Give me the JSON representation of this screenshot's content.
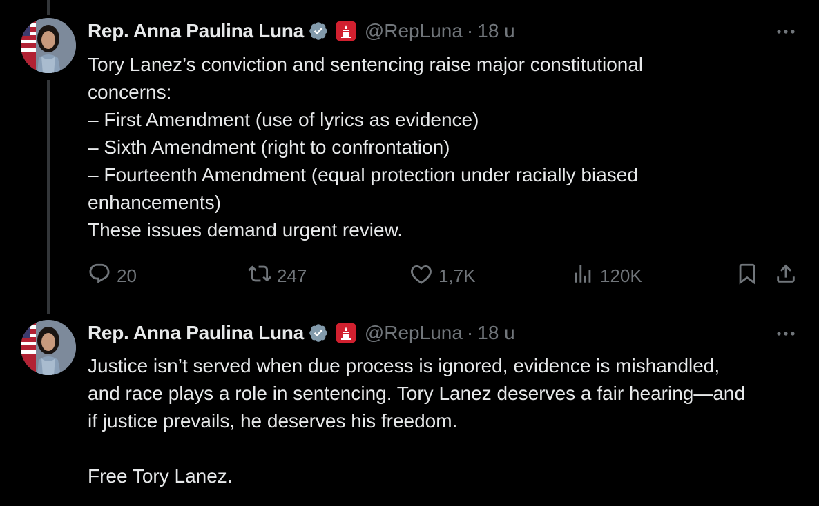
{
  "colors": {
    "background": "#000000",
    "text": "#e7e9ea",
    "muted": "#71767b",
    "verified": "#829aab",
    "gov_badge": "#d1202f"
  },
  "tweets": [
    {
      "author_name": "Rep. Anna Paulina Luna",
      "handle": "@RepLuna",
      "separator": "·",
      "time": "18 u",
      "text": "Tory Lanez’s conviction and sentencing raise major constitutional\nconcerns:\n– First Amendment (use of lyrics as evidence)\n– Sixth Amendment (right to confrontation)\n– Fourteenth Amendment (equal protection under racially biased\nenhancements)\nThese issues demand urgent review.",
      "replies": "20",
      "reposts": "247",
      "likes": "1,7K",
      "views": "120K",
      "icons": [
        "verified-icon",
        "government-badge-icon",
        "more-icon",
        "reply-icon",
        "repost-icon",
        "like-icon",
        "views-icon",
        "bookmark-icon",
        "share-icon"
      ]
    },
    {
      "author_name": "Rep. Anna Paulina Luna",
      "handle": "@RepLuna",
      "separator": "·",
      "time": "18 u",
      "text": "Justice isn’t served when due process is ignored, evidence is mishandled,\nand race plays a role in sentencing. Tory Lanez deserves a fair hearing—and\nif justice prevails, he deserves his freedom.\n\nFree Tory Lanez."
    }
  ]
}
